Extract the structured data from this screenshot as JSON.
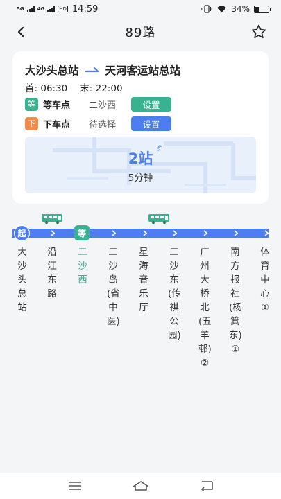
{
  "status": {
    "signal1": "5G",
    "signal2": "4G",
    "hd": "HD",
    "time": "14:59",
    "battery": "34%",
    "battery_level": 0.34
  },
  "header": {
    "title": "89路"
  },
  "route": {
    "origin": "大沙头总站",
    "destination": "天河客运站总站",
    "first_label": "首:",
    "first_time": "06:30",
    "last_label": "末:",
    "last_time": "22:00",
    "wait_tag": "等",
    "wait_label": "等车点",
    "wait_value": "二沙西",
    "wait_button": "设置",
    "alight_tag": "下",
    "alight_label": "下车点",
    "alight_value": "待选择",
    "alight_button": "设置"
  },
  "eta": {
    "stops": "2站",
    "minutes": "5分钟"
  },
  "line": {
    "start_badge": "起",
    "wait_badge": "等",
    "stations": [
      "大沙头总站",
      "沿江东路",
      "二沙西",
      "二沙岛(省中医)",
      "星海音乐厅",
      "二沙东(传祺公园)",
      "广州大桥北(五羊邨)②",
      "南方报社(杨箕东)①",
      "体育中心①"
    ]
  },
  "colors": {
    "accent_blue": "#4d7ef0",
    "accent_green": "#39b28f",
    "accent_orange": "#f38b4b"
  }
}
